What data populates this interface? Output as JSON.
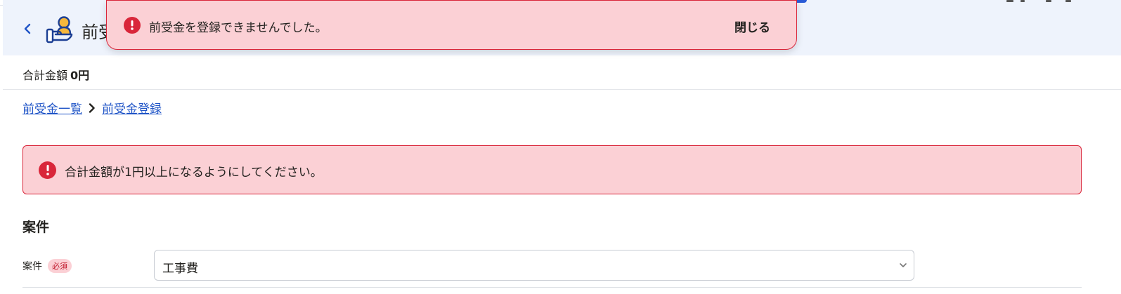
{
  "header": {
    "title": "前受金登録",
    "back_icon": "chevron-left-icon",
    "page_icon": "hand-with-person-icon"
  },
  "toast": {
    "message": "前受金を登録できませんでした。",
    "close_label": "閉じる",
    "icon": "error-exclamation-icon"
  },
  "summary": {
    "total_label": "合計金額",
    "total_value": "0円"
  },
  "breadcrumb": {
    "items": [
      "前受金一覧",
      "前受金登録"
    ]
  },
  "alert": {
    "message": "合計金額が1円以上になるようにしてください。",
    "icon": "error-exclamation-icon"
  },
  "section": {
    "title": "案件"
  },
  "form": {
    "project_label": "案件",
    "required_badge": "必須",
    "project_value": "工事費"
  },
  "colors": {
    "accent": "#1f54c7",
    "error": "#d9263a",
    "error_bg": "#fbd0d5",
    "header_bg": "#eef3fc"
  }
}
